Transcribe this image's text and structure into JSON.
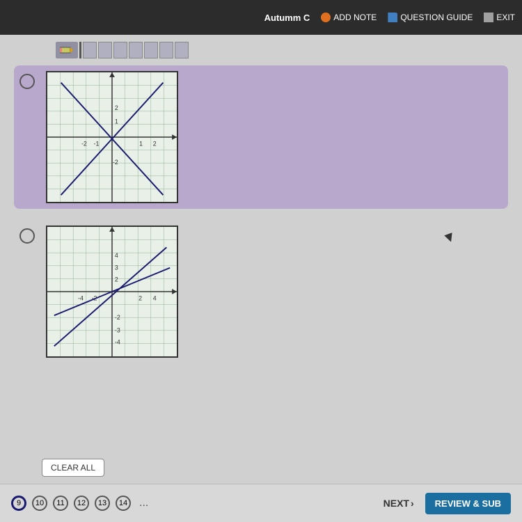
{
  "topbar": {
    "username": "Autumm C",
    "add_note_label": "ADD NOTE",
    "question_guide_label": "QUESTION GUIDE",
    "exit_label": "EXIT"
  },
  "toolbar": {
    "icons": [
      "pencil",
      "separator",
      "box1",
      "box2",
      "box3",
      "box4",
      "box5",
      "box6",
      "box7"
    ]
  },
  "options": [
    {
      "id": "option-a",
      "selected": true,
      "graph_label": "Graph A - two intersecting lines forming X shape"
    },
    {
      "id": "option-b",
      "selected": false,
      "graph_label": "Graph B - two lines crossing at center"
    }
  ],
  "buttons": {
    "clear_all": "CLEAR ALL",
    "next": "NEXT",
    "review_submit": "REVIEW & SUB"
  },
  "pagination": {
    "pages": [
      "9",
      "10",
      "11",
      "12",
      "13",
      "14"
    ],
    "current": "9",
    "dots": "..."
  }
}
